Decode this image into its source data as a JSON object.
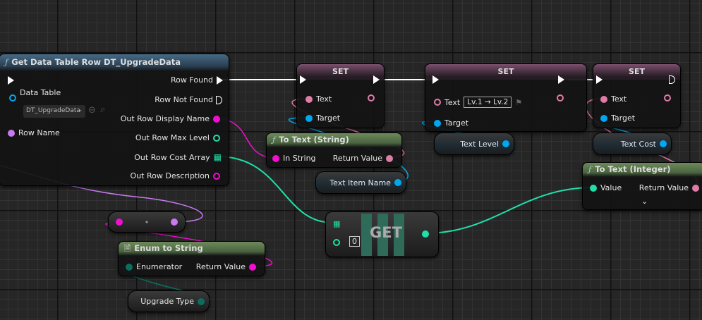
{
  "colors": {
    "exec": "#ffffff",
    "text": "#e07ba6",
    "string": "#f00fd0",
    "object": "#00a8f0",
    "int": "#1fe0a9",
    "name": "#c87af0",
    "byte": "#0a6e61"
  },
  "get_row": {
    "title": "Get Data Table Row DT_UpgradeData",
    "icon": "function-icon",
    "data_table_label": "Data Table",
    "data_table_value": "DT_UpgradeData",
    "row_name": "Row Name",
    "row_found": "Row Found",
    "row_not_found": "Row Not Found",
    "outputs": [
      "Out Row Display Name",
      "Out Row Max Level",
      "Out Row Cost Array",
      "Out Row Description"
    ]
  },
  "set1": {
    "title": "SET",
    "text": "Text",
    "target": "Target"
  },
  "set2": {
    "title": "SET",
    "text": "Text",
    "text_value": "Lv.1 → Lv.2",
    "target": "Target"
  },
  "set3": {
    "title": "SET",
    "text": "Text",
    "target": "Target"
  },
  "to_text_string": {
    "title": "To Text (String)",
    "in": "In String",
    "out": "Return Value"
  },
  "to_text_int": {
    "title": "To Text (Integer)",
    "in": "Value",
    "out": "Return Value"
  },
  "enum_to_string": {
    "title": "Enum to String",
    "in": "Enumerator",
    "out": "Return Value"
  },
  "vars": {
    "item_name": "Text Item Name",
    "level": "Text Level",
    "cost": "Text Cost",
    "upgrade_type": "Upgrade Type"
  },
  "get": {
    "title": "GET",
    "index": "0"
  },
  "reroute": {
    "dot": "•"
  }
}
